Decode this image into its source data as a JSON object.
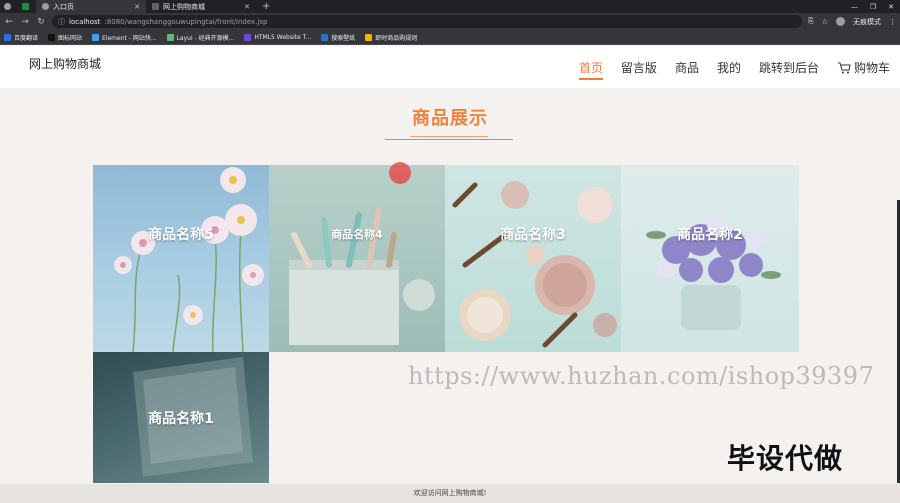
{
  "browser": {
    "tabs": [
      {
        "label": "入口页",
        "active": true
      },
      {
        "label": "网上购物商城",
        "active": false
      }
    ],
    "new_tab": "+",
    "window_buttons": [
      "—",
      "❐",
      "✕"
    ],
    "url_host": "localhost",
    "url_path": ":8080/wangshanggouwupingtai/front/index.jsp",
    "profile_label": "无痕模式",
    "bookmarks": [
      {
        "label": "百度翻译",
        "color": "#2f6ee0"
      },
      {
        "label": "图标网站",
        "color": "#111111"
      },
      {
        "label": "Element - 网站快...",
        "color": "#409eff"
      },
      {
        "label": "Layui - 经典开源模...",
        "color": "#5fb878"
      },
      {
        "label": "HTML5 Website T...",
        "color": "#6c4ad6"
      },
      {
        "label": "搜索壁纸",
        "color": "#2a6fd6"
      },
      {
        "label": "即时商品购规则",
        "color": "#f0b400"
      }
    ]
  },
  "header": {
    "logo": "网上购物商城",
    "menu": [
      {
        "label": "首页",
        "active": true
      },
      {
        "label": "留言版",
        "active": false
      },
      {
        "label": "商品",
        "active": false
      },
      {
        "label": "我的",
        "active": false
      },
      {
        "label": "跳转到后台",
        "active": false
      },
      {
        "label": "购物车",
        "active": false,
        "icon": "cart-icon"
      }
    ]
  },
  "section": {
    "title": "商品展示"
  },
  "products": [
    {
      "name": "商品名称5",
      "image": "flowers-sky"
    },
    {
      "name": "商品名称4",
      "image": "makeup-brushes"
    },
    {
      "name": "商品名称3",
      "image": "eyeshadow-palette"
    },
    {
      "name": "商品名称2",
      "image": "bouquet-vase"
    },
    {
      "name": "商品名称1",
      "image": "laptop-dark"
    }
  ],
  "watermarks": {
    "url": "https://www.huzhan.com/ishop39397",
    "text": "毕设代做"
  },
  "footer": {
    "text": "欢迎访问网上购物商城!"
  },
  "colors": {
    "accent": "#f47a3c",
    "title": "#f0833c"
  }
}
